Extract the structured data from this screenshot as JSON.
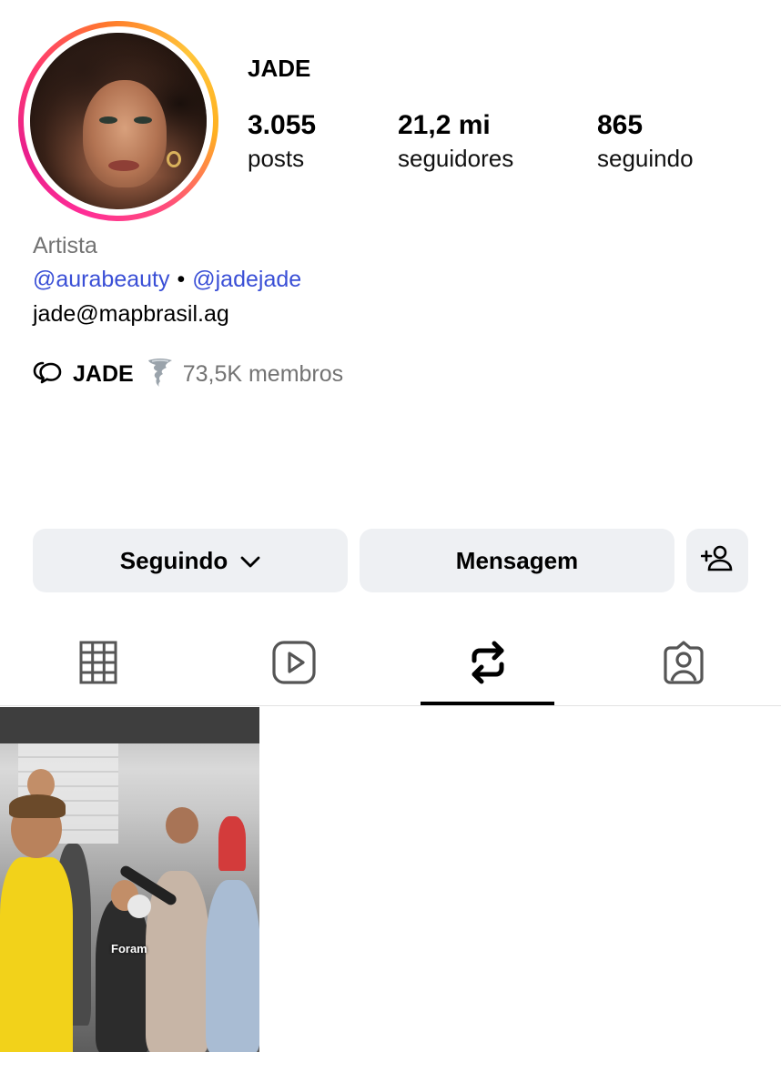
{
  "profile": {
    "username": "JADE",
    "stats": [
      {
        "value": "3.055",
        "label": "posts"
      },
      {
        "value": "21,2 mi",
        "label": "seguidores"
      },
      {
        "value": "865",
        "label": "seguindo"
      }
    ],
    "category": "Artista",
    "links": [
      "@aurabeauty",
      "@jadejade"
    ],
    "link_separator": "•",
    "email": "jade@mapbrasil.ag"
  },
  "channel": {
    "name": "JADE",
    "members": "73,5K membros"
  },
  "actions": {
    "following_label": "Seguindo",
    "message_label": "Mensagem"
  },
  "tabs": [
    {
      "icon": "grid-icon",
      "active": false
    },
    {
      "icon": "reels-icon",
      "active": false
    },
    {
      "icon": "reposts-icon",
      "active": true
    },
    {
      "icon": "tagged-icon",
      "active": false
    }
  ],
  "posts": [
    {
      "caption": "Foram"
    }
  ]
}
